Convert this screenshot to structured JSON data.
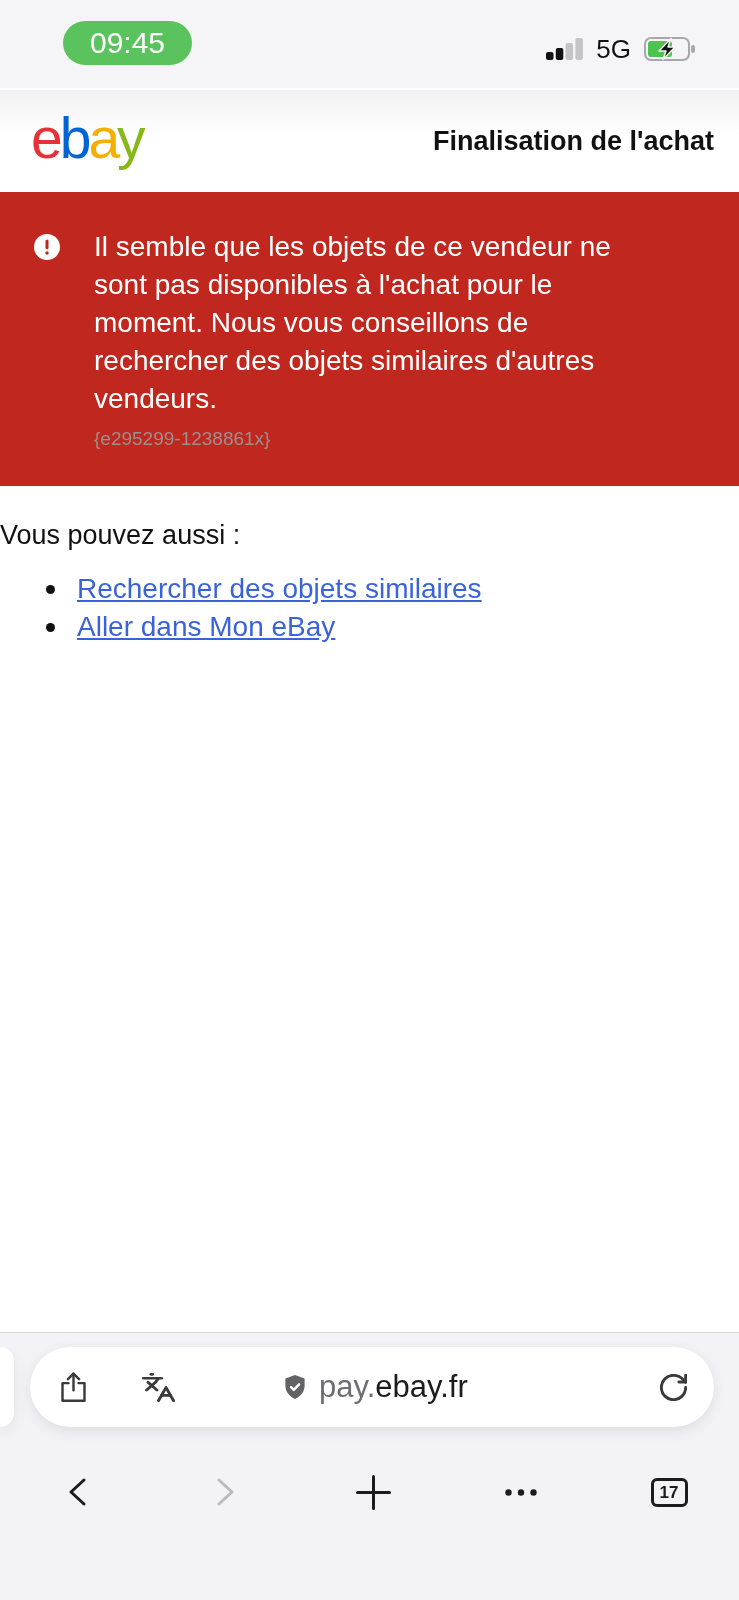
{
  "status_bar": {
    "time": "09:45",
    "network": "5G",
    "charging": true
  },
  "header": {
    "logo": "ebay",
    "title": "Finalisation de l'achat"
  },
  "alert": {
    "message": "Il semble que les objets de ce vendeur ne sont pas disponibles à l'achat pour le moment. Nous vous conseillons de rechercher des objets similaires d'autres vendeurs.",
    "code": "{e295299-1238861x}"
  },
  "alternatives": {
    "intro": "Vous pouvez aussi :",
    "links": [
      "Rechercher des objets similaires",
      "Aller dans Mon eBay"
    ]
  },
  "browser": {
    "url_subdomain": "pay.",
    "url_domain": "ebay.fr",
    "nav": [
      {
        "kind": "back",
        "disabled": false
      },
      {
        "kind": "forward",
        "disabled": true
      },
      {
        "kind": "new-tab",
        "disabled": false
      },
      {
        "kind": "more",
        "disabled": false
      },
      {
        "kind": "tabs",
        "disabled": false,
        "count": "17"
      }
    ]
  }
}
